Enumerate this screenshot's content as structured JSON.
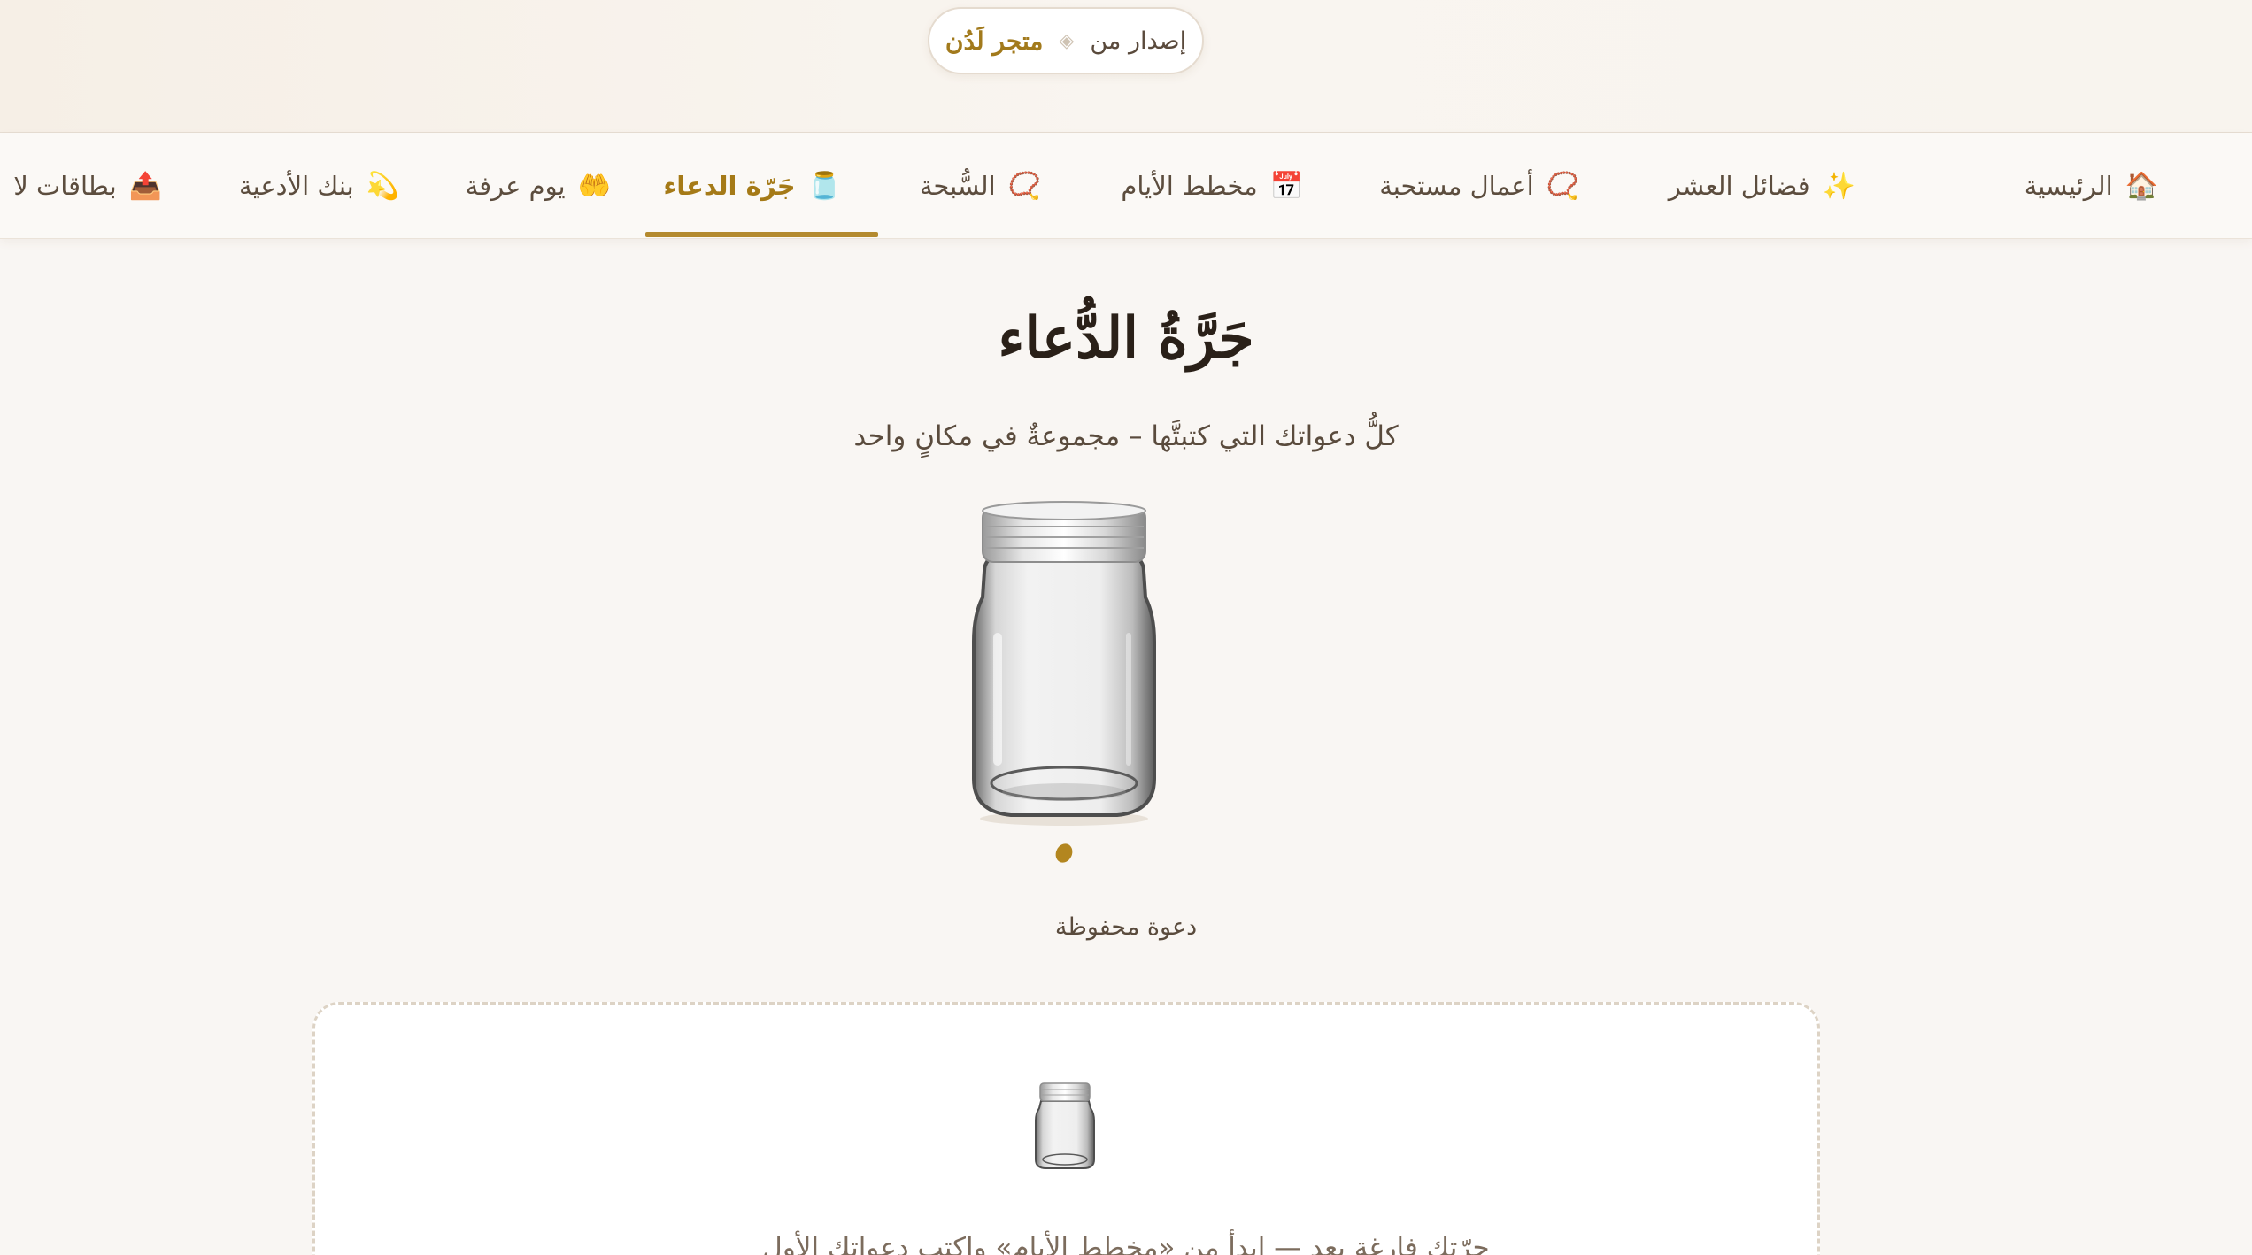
{
  "header": {
    "release_prefix": "إصدار من",
    "separator_icon": "diamond-icon",
    "store_name": "متجر لَدُن"
  },
  "nav": {
    "items": [
      {
        "label": "الرئيسية",
        "icon": "🏠",
        "icon_name": "house-icon"
      },
      {
        "label": "فضائل العشر",
        "icon": "✨",
        "icon_name": "sparkles-icon"
      },
      {
        "label": "أعمال مستحبة",
        "icon": "📿",
        "icon_name": "prayer-beads-icon"
      },
      {
        "label": "مخطط الأيام",
        "icon": "📅",
        "icon_name": "calendar-icon"
      },
      {
        "label": "السُّبحة",
        "icon": "📿",
        "icon_name": "prayer-beads-icon"
      },
      {
        "label": "جَرّة الدعاء",
        "icon": "🫙",
        "icon_name": "jar-icon",
        "active": true
      },
      {
        "label": "يوم عرفة",
        "icon": "🤲",
        "icon_name": "raised-hands-icon"
      },
      {
        "label": "بنك الأدعية",
        "icon": "💫",
        "icon_name": "dizzy-star-icon"
      },
      {
        "label": "بطاقات لا",
        "icon": "📤",
        "icon_name": "outbox-tray-icon"
      }
    ]
  },
  "main": {
    "title": "جَرَّةُ الدُّعاء",
    "subtitle": "كلُّ دعواتك التي كتبتَّها – مجموعةٌ في مكانٍ واحد",
    "saved_label": "دعوة محفوظة",
    "empty_text": "جرّتك فارغة بعد — ابدأ من «مخطط الأيام» واكتب دعواتك الأول"
  },
  "colors": {
    "accent": "#a57a17",
    "underline": "#b48a2e",
    "background": "#f9f6f3",
    "text": "#4a3c30"
  }
}
